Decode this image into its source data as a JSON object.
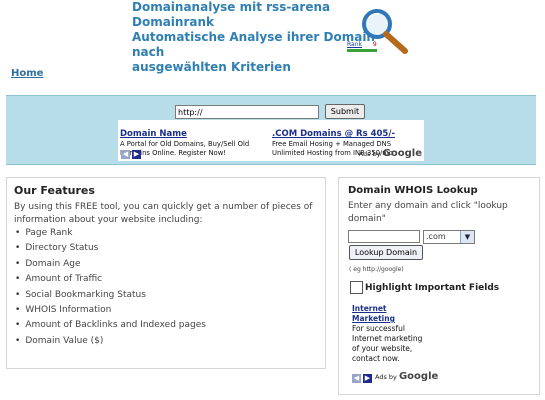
{
  "header": {
    "title_lines": [
      "Domainanalyse mit rss-arena Domainrank",
      "Automatische Analyse ihrer Domain nach",
      "ausgewählten Kriterien"
    ],
    "rank_label": "Rank",
    "rank_value": "9"
  },
  "nav": {
    "home_label": "Home"
  },
  "search": {
    "input_value": "http://",
    "submit_label": "Submit"
  },
  "top_ads": {
    "ads": [
      {
        "title": "Domain Name",
        "text": "A Portal for Old Domains, Buy/Sell Old Domains Online. Register Now!"
      },
      {
        "title": ".COM Domains @ Rs 405/-",
        "text": "Free Email Hosing + Managed DNS Unlimited Hosting from INR 350/mo"
      }
    ],
    "ads_by_label": "Ads by",
    "google_label": "Google"
  },
  "features": {
    "heading": "Our Features",
    "intro": "By using this FREE tool, you can quickly get a number of pieces of information about your website including:",
    "items": [
      "Page Rank",
      "Directory Status",
      "Domain Age",
      "Amount of Traffic",
      "Social Bookmarking Status",
      "WHOIS Information",
      "Amount of Backlinks and Indexed pages",
      "Domain Value ($)"
    ]
  },
  "whois": {
    "heading": "Domain WHOIS Lookup",
    "intro": "Enter any domain and click \"lookup domain\"",
    "domain_value": "",
    "tld_selected": ".com",
    "lookup_label": "Lookup Domain",
    "example_text": "( eg http://google)",
    "highlight_label": "Highlight Important Fields",
    "ad": {
      "title": "Internet Marketing",
      "text": "For successful Internet marketing of your website, contact now."
    },
    "ads_by_label": "Ads by",
    "google_label": "Google"
  },
  "colors": {
    "title_blue": "#2f7fb3",
    "band_bg": "#b7dde8",
    "ad_title_blue": "#1a2f8a",
    "nav_arrow_blue": "#1f2a8a",
    "nav_arrow_grey": "#9aa4c7"
  }
}
